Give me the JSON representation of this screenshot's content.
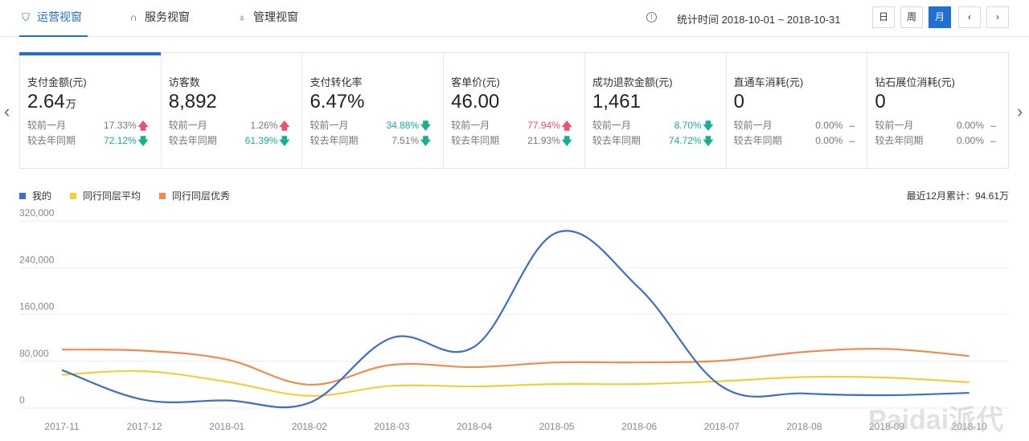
{
  "tabs": [
    {
      "label": "运营视窗",
      "active": true,
      "icon": "shield-icon"
    },
    {
      "label": "服务视窗",
      "active": false,
      "icon": "headset-icon"
    },
    {
      "label": "管理视窗",
      "active": false,
      "icon": "medal-icon"
    }
  ],
  "header": {
    "stat_time": "统计时间 2018-10-01 ~ 2018-10-31",
    "period_buttons": [
      "日",
      "周",
      "月"
    ],
    "active_period": "月"
  },
  "cards": [
    {
      "title": "支付金额(元)",
      "value": "2.64",
      "unit": "万",
      "compare_label_1": "较前一月",
      "compare_value_1": "17.33%",
      "trend_1": "up",
      "compare_label_2": "较去年同期",
      "compare_value_2": "72.12%",
      "trend_2": "down"
    },
    {
      "title": "访客数",
      "value": "8,892",
      "unit": "",
      "compare_label_1": "较前一月",
      "compare_value_1": "1.26%",
      "trend_1": "up",
      "compare_label_2": "较去年同期",
      "compare_value_2": "61.39%",
      "trend_2": "down"
    },
    {
      "title": "支付转化率",
      "value": "6.47%",
      "unit": "",
      "compare_label_1": "较前一月",
      "compare_value_1": "34.88%",
      "trend_1": "down",
      "compare_label_2": "较去年同期",
      "compare_value_2": "7.51%",
      "trend_2": "down"
    },
    {
      "title": "客单价(元)",
      "value": "46.00",
      "unit": "",
      "compare_label_1": "较前一月",
      "compare_value_1": "77.94%",
      "trend_1": "up",
      "compare_label_2": "较去年同期",
      "compare_value_2": "21.93%",
      "trend_2": "down"
    },
    {
      "title": "成功退款金额(元)",
      "value": "1,461",
      "unit": "",
      "compare_label_1": "较前一月",
      "compare_value_1": "8.70%",
      "trend_1": "down",
      "compare_label_2": "较去年同期",
      "compare_value_2": "74.72%",
      "trend_2": "down"
    },
    {
      "title": "直通车消耗(元)",
      "value": "0",
      "unit": "",
      "compare_label_1": "较前一月",
      "compare_value_1": "0.00%",
      "trend_1": "flat",
      "compare_label_2": "较去年同期",
      "compare_value_2": "0.00%",
      "trend_2": "flat"
    },
    {
      "title": "钻石展位消耗(元)",
      "value": "0",
      "unit": "",
      "compare_label_1": "较前一月",
      "compare_value_1": "0.00%",
      "trend_1": "flat",
      "compare_label_2": "较去年同期",
      "compare_value_2": "0.00%",
      "trend_2": "flat"
    }
  ],
  "legend_total": "最近12月累计：94.61万",
  "watermark": "Paidai派代",
  "colors": {
    "accent": "#1f6fd4",
    "mine": "#3d6fc4",
    "avg": "#f2d03b",
    "best": "#ef8c4c",
    "up": "#e8546e",
    "down": "#1aae92"
  },
  "chart_data": {
    "type": "line",
    "categories": [
      "2017-11",
      "2017-12",
      "2018-01",
      "2018-02",
      "2018-03",
      "2018-04",
      "2018-05",
      "2018-06",
      "2018-07",
      "2018-08",
      "2018-09",
      "2018-10"
    ],
    "yticks": [
      0,
      80000,
      160000,
      240000,
      320000
    ],
    "yticklabels": [
      "0",
      "80,000",
      "160,000",
      "240,000",
      "320,000"
    ],
    "ylim": [
      0,
      320000
    ],
    "grid": true,
    "legend_position": "top-left",
    "series": [
      {
        "name": "我的",
        "color": "#3d6fc4",
        "values": [
          65000,
          14000,
          13000,
          9000,
          120000,
          105000,
          300000,
          205000,
          37000,
          25000,
          22000,
          26000
        ]
      },
      {
        "name": "同行同层平均",
        "color": "#f2d03b",
        "values": [
          57000,
          63000,
          45000,
          21000,
          38000,
          37000,
          41000,
          41000,
          46000,
          53000,
          52000,
          44000
        ]
      },
      {
        "name": "同行同层优秀",
        "color": "#ef8c4c",
        "values": [
          100000,
          98000,
          83000,
          40000,
          74000,
          70000,
          78000,
          78000,
          81000,
          96000,
          101000,
          89000
        ]
      }
    ]
  }
}
